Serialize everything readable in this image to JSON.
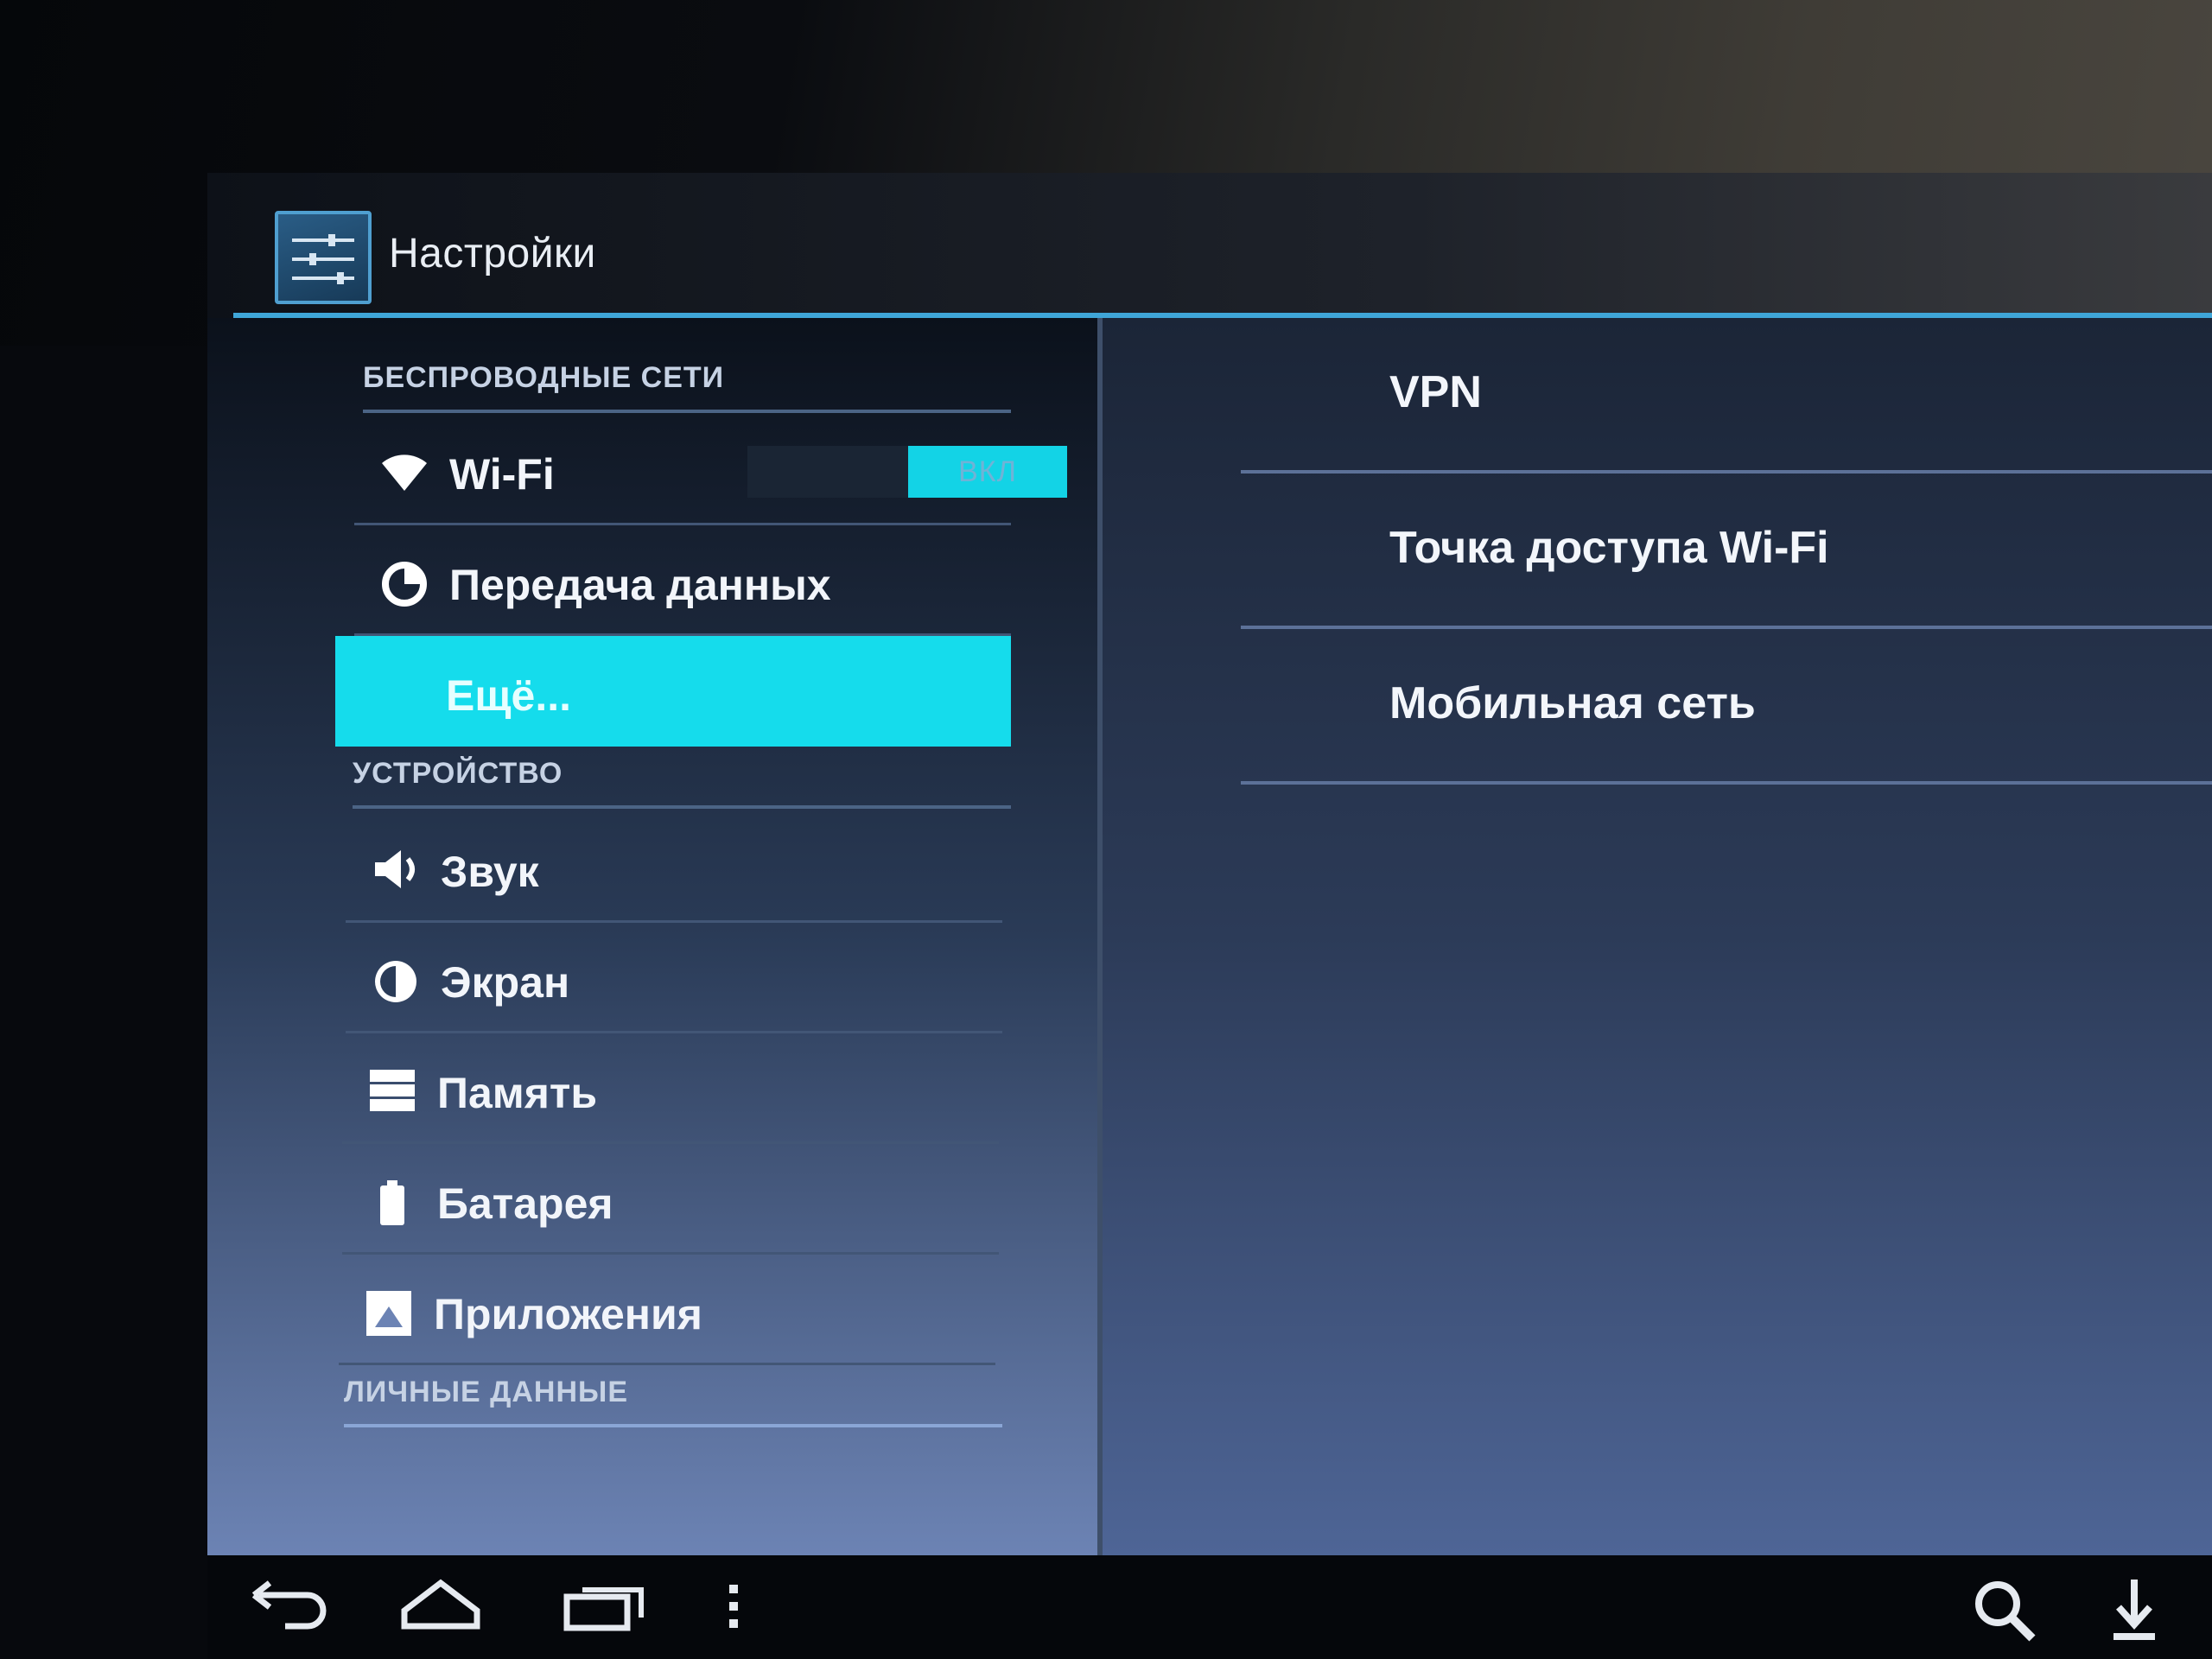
{
  "action_bar": {
    "title": "Настройки",
    "icon": "settings-sliders-icon"
  },
  "sidebar": {
    "sections": [
      {
        "header": "БЕСПРОВОДНЫЕ СЕТИ",
        "items": [
          {
            "label": "Wi-Fi",
            "icon": "wifi-icon",
            "toggle": "ВКЛ"
          },
          {
            "label": "Передача данных",
            "icon": "data-usage-icon"
          },
          {
            "label": "Ещё...",
            "icon": "",
            "selected": true
          }
        ]
      },
      {
        "header": "УСТРОЙСТВО",
        "items": [
          {
            "label": "Звук",
            "icon": "speaker-icon"
          },
          {
            "label": "Экран",
            "icon": "brightness-icon"
          },
          {
            "label": "Память",
            "icon": "storage-icon"
          },
          {
            "label": "Батарея",
            "icon": "battery-icon"
          },
          {
            "label": "Приложения",
            "icon": "apps-icon"
          }
        ]
      },
      {
        "header": "ЛИЧНЫЕ ДАННЫЕ",
        "items": []
      }
    ]
  },
  "detail": {
    "items": [
      {
        "label": "VPN"
      },
      {
        "label": "Точка доступа Wi-Fi"
      },
      {
        "label": "Мобильная сеть"
      }
    ]
  },
  "nav_bar": {
    "left": [
      "back-icon",
      "home-icon",
      "recent-apps-icon",
      "menu-overflow-icon"
    ],
    "right": [
      "search-icon",
      "download-icon"
    ]
  },
  "colors": {
    "accent": "#15dcec",
    "divider": "#3fa6d8"
  }
}
